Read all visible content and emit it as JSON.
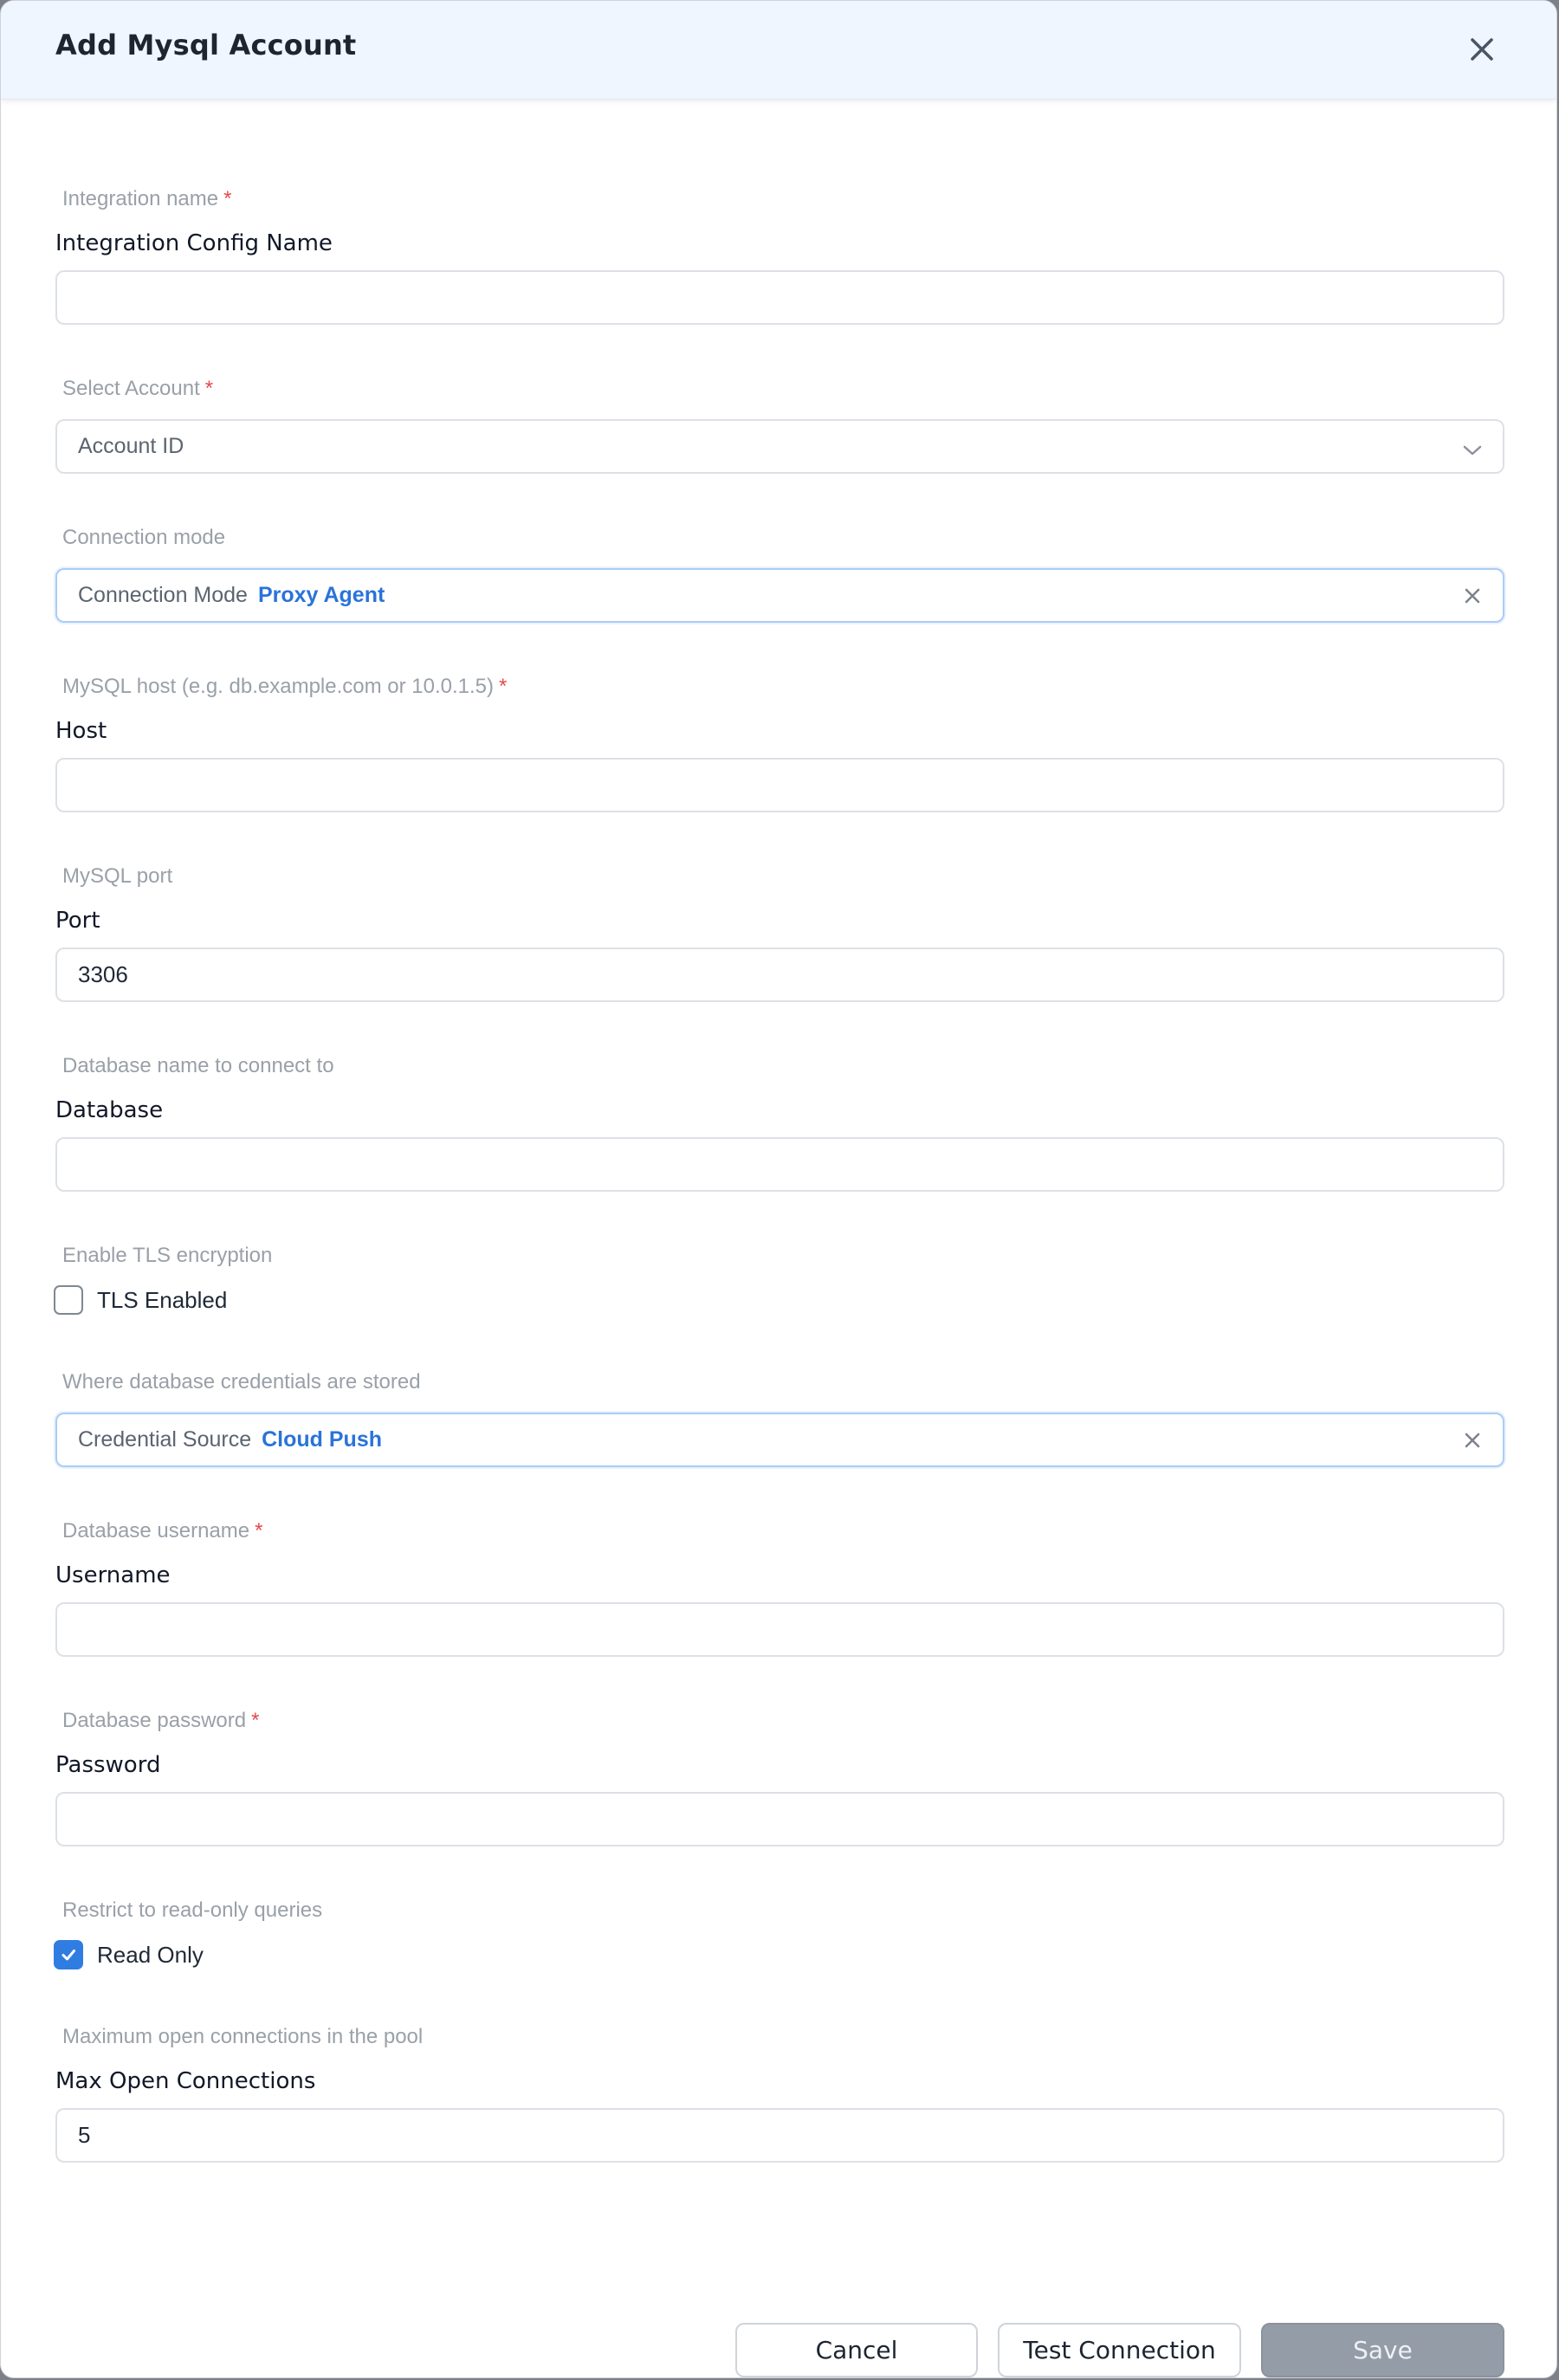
{
  "dialog": {
    "title": "Add Mysql Account"
  },
  "fields": {
    "integration_name": {
      "hint": "Integration name",
      "label": "Integration Config Name",
      "value": ""
    },
    "account": {
      "hint": "Select Account",
      "selected": "Account ID"
    },
    "connection_mode": {
      "hint": "Connection mode",
      "chip_label": "Connection Mode",
      "chip_value": "Proxy Agent"
    },
    "host": {
      "hint": "MySQL host (e.g. db.example.com or 10.0.1.5)",
      "label": "Host",
      "value": ""
    },
    "port": {
      "hint": "MySQL port",
      "label": "Port",
      "value": "3306"
    },
    "database": {
      "hint": "Database name to connect to",
      "label": "Database",
      "value": ""
    },
    "tls": {
      "hint": "Enable TLS encryption",
      "label": "TLS Enabled",
      "checked": false
    },
    "credential_source": {
      "hint": "Where database credentials are stored",
      "chip_label": "Credential Source",
      "chip_value": "Cloud Push"
    },
    "username": {
      "hint": "Database username",
      "label": "Username",
      "value": ""
    },
    "password": {
      "hint": "Database password",
      "label": "Password",
      "value": ""
    },
    "read_only": {
      "hint": "Restrict to read-only queries",
      "label": "Read Only",
      "checked": true
    },
    "max_open": {
      "hint": "Maximum open connections in the pool",
      "label": "Max Open Connections",
      "value": "5"
    }
  },
  "required_mark": "*",
  "buttons": {
    "cancel": "Cancel",
    "test": "Test Connection",
    "save": "Save"
  },
  "colors": {
    "accent": "#2f7de1",
    "chip_value": "#2a73d9",
    "required": "#e5484d",
    "save_disabled": "#949ca8"
  }
}
